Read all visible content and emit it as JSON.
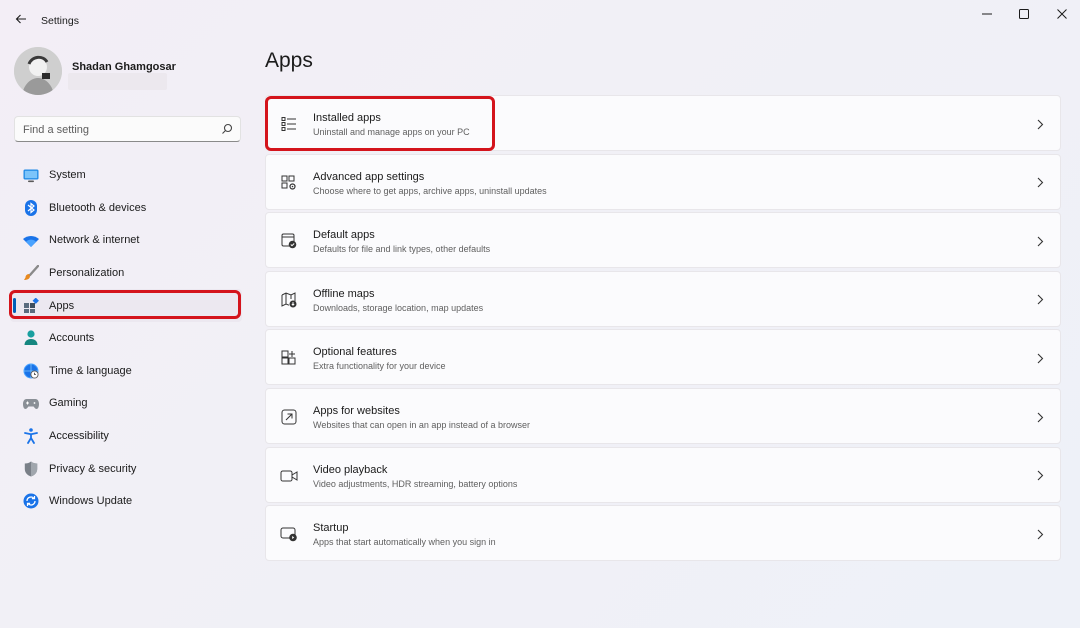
{
  "window": {
    "title": "Settings",
    "back_icon": "back-arrow-icon",
    "controls": [
      "minimize-icon",
      "maximize-icon",
      "close-icon"
    ]
  },
  "profile": {
    "name": "Shadan Ghamgosar",
    "avatar_icon": "avatar"
  },
  "search": {
    "placeholder": "Find a setting",
    "value": "",
    "icon": "search-icon"
  },
  "sidebar": {
    "selected": "Apps",
    "items": [
      {
        "label": "System",
        "icon": "monitor-icon"
      },
      {
        "label": "Bluetooth & devices",
        "icon": "bluetooth-icon"
      },
      {
        "label": "Network & internet",
        "icon": "wifi-icon"
      },
      {
        "label": "Personalization",
        "icon": "brush-icon"
      },
      {
        "label": "Apps",
        "icon": "apps-icon"
      },
      {
        "label": "Accounts",
        "icon": "person-icon"
      },
      {
        "label": "Time & language",
        "icon": "globe-clock-icon"
      },
      {
        "label": "Gaming",
        "icon": "gamepad-icon"
      },
      {
        "label": "Accessibility",
        "icon": "accessibility-icon"
      },
      {
        "label": "Privacy & security",
        "icon": "shield-icon"
      },
      {
        "label": "Windows Update",
        "icon": "update-icon"
      }
    ]
  },
  "main": {
    "title": "Apps",
    "cards": [
      {
        "title": "Installed apps",
        "subtitle": "Uninstall and manage apps on your PC",
        "icon": "list-icon"
      },
      {
        "title": "Advanced app settings",
        "subtitle": "Choose where to get apps, archive apps, uninstall updates",
        "icon": "app-settings-icon"
      },
      {
        "title": "Default apps",
        "subtitle": "Defaults for file and link types, other defaults",
        "icon": "default-apps-icon"
      },
      {
        "title": "Offline maps",
        "subtitle": "Downloads, storage location, map updates",
        "icon": "map-icon"
      },
      {
        "title": "Optional features",
        "subtitle": "Extra functionality for your device",
        "icon": "add-grid-icon"
      },
      {
        "title": "Apps for websites",
        "subtitle": "Websites that can open in an app instead of a browser",
        "icon": "open-link-icon"
      },
      {
        "title": "Video playback",
        "subtitle": "Video adjustments, HDR streaming, battery options",
        "icon": "video-icon"
      },
      {
        "title": "Startup",
        "subtitle": "Apps that start automatically when you sign in",
        "icon": "startup-icon"
      }
    ]
  },
  "colors": {
    "accent": "#005fb8",
    "highlight": "#d4141c"
  }
}
